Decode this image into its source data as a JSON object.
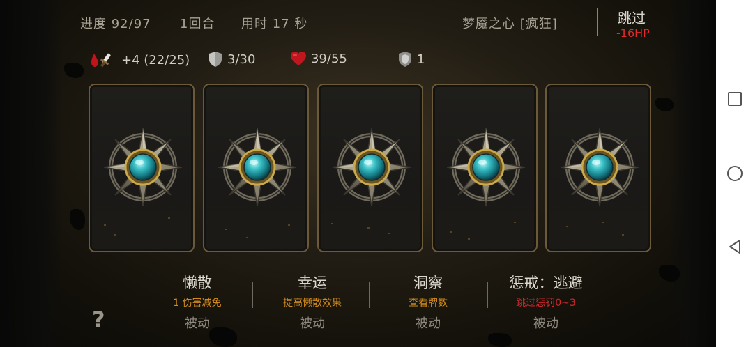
{
  "header": {
    "progress": "进度 92/97",
    "round": "1回合",
    "time": "用时 17 秒",
    "dungeon": "梦魇之心 [疯狂]",
    "skip_label": "跳过",
    "skip_penalty": "-16HP"
  },
  "stats": {
    "attack": "+4 (22/25)",
    "armor": "3/30",
    "health": "39/55",
    "shield": "1"
  },
  "cards": [
    {
      "icon": "compass-emblem-icon"
    },
    {
      "icon": "compass-emblem-icon"
    },
    {
      "icon": "compass-emblem-icon"
    },
    {
      "icon": "compass-emblem-icon"
    },
    {
      "icon": "compass-emblem-icon"
    }
  ],
  "options": [
    {
      "name": "懒散",
      "desc": "1 伤害减免",
      "kind": "被动"
    },
    {
      "name": "幸运",
      "desc": "提高懒散效果",
      "kind": "被动"
    },
    {
      "name": "洞察",
      "desc": "查看牌数",
      "kind": "被动"
    },
    {
      "name": "惩戒：逃避",
      "desc": "跳过惩罚0~3",
      "kind": "被动"
    }
  ],
  "help": "?",
  "colors": {
    "penalty_red": "#e32b2b",
    "desc_orange": "#d08a1e",
    "card_border": "#6b5a3a",
    "gem_teal": "#2aa4b0"
  }
}
